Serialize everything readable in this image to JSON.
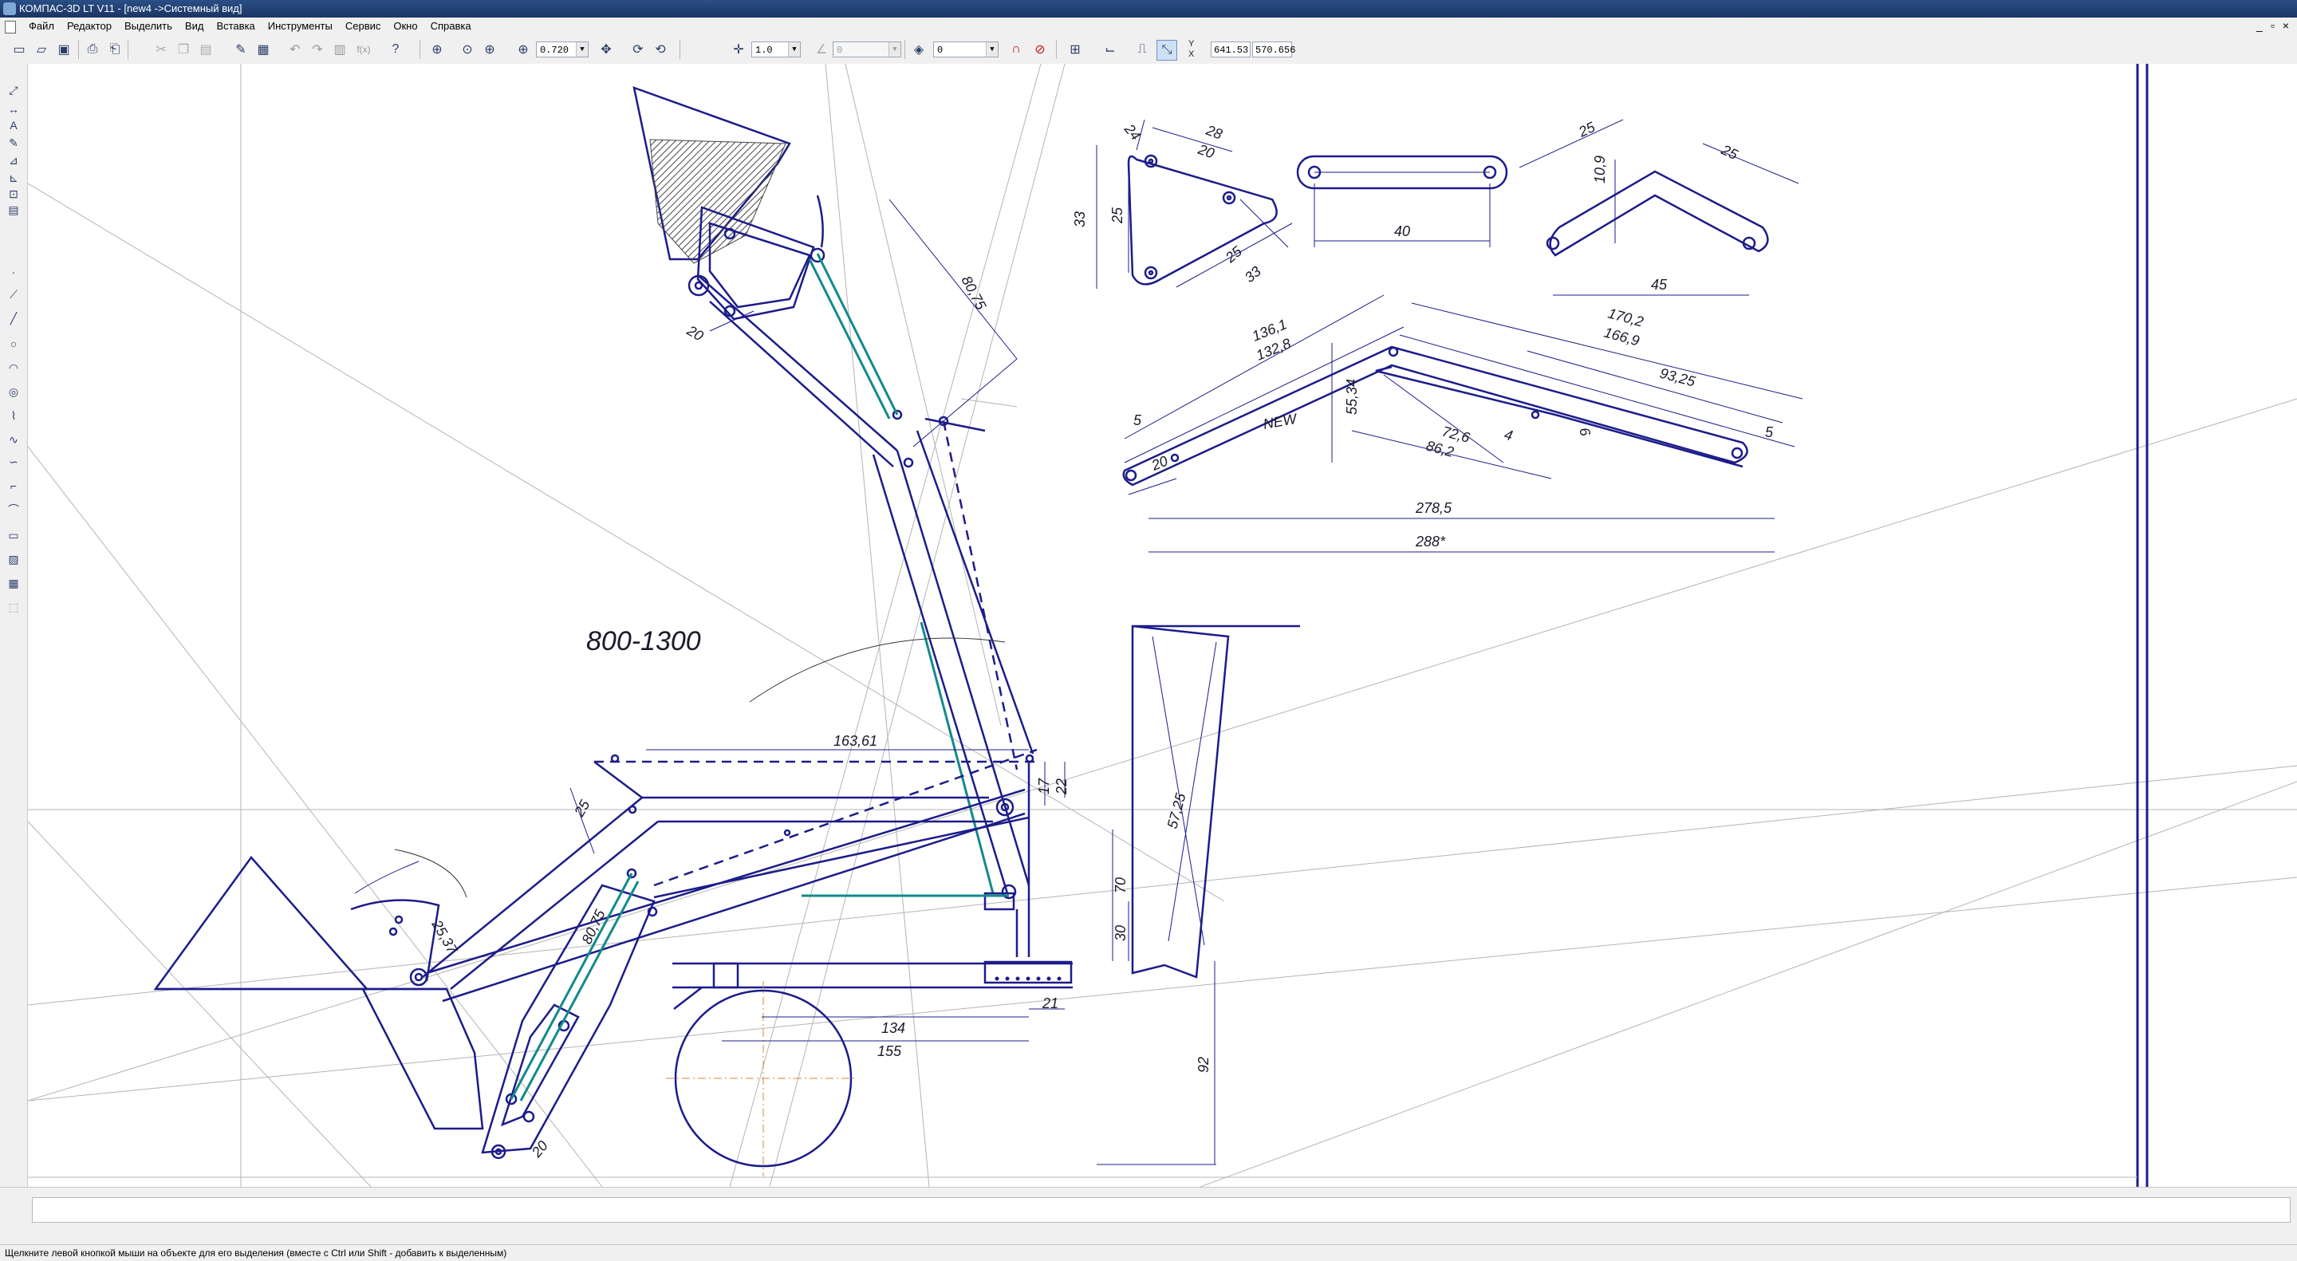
{
  "window": {
    "title": "КОМПАС-3D LT V11 - [new4 ->Системный вид]",
    "controls": [
      "_",
      "▫",
      "×"
    ]
  },
  "menu": {
    "items": [
      "Файл",
      "Редактор",
      "Выделить",
      "Вид",
      "Вставка",
      "Инструменты",
      "Сервис",
      "Окно",
      "Справка"
    ]
  },
  "toolbar": {
    "zoom_value": "0.720",
    "step_value": "1.0",
    "angle_value": "0",
    "layer_value": "0",
    "coord_x": "641.53",
    "coord_y": "570.656",
    "coord_labels": [
      "Y",
      "X"
    ]
  },
  "drawing": {
    "range_label": "800-1300",
    "part_new_label": "NEW",
    "dims": {
      "d_80_75_top": "80,75",
      "d_20_bucket": "20",
      "d_24": "24",
      "d_28": "28",
      "d_20_tri": "20",
      "d_33_v": "33",
      "d_25_v": "25",
      "d_25_tri": "25",
      "d_33_tri": "33",
      "d_40": "40",
      "d_25_a": "25",
      "d_25_b": "25",
      "d_10_9": "10,9",
      "d_45": "45",
      "d_136_1": "136,1",
      "d_132_8": "132,8",
      "d_170_2": "170,2",
      "d_166_9": "166,9",
      "d_93_25": "93,25",
      "d_55_34": "55,34",
      "d_72_6": "72,6",
      "d_86_2": "86,2",
      "d_4": "4",
      "d_6": "6",
      "d_5_left": "5",
      "d_5_right": "5",
      "d_20_arm": "20",
      "d_278_5": "278,5",
      "d_288": "288*",
      "d_163_61": "163,61",
      "d_25_low": "25",
      "d_17": "17",
      "d_22": "22",
      "d_57_25": "57,25",
      "d_70": "70",
      "d_30": "30",
      "d_25_37": "25,37",
      "d_80_75_low": "80,75",
      "d_134": "134",
      "d_155": "155",
      "d_21": "21",
      "d_92": "92",
      "d_20_low": "20"
    }
  },
  "status": {
    "hint": "Щелкните левой кнопкой мыши на объекте для его выделения (вместе с Ctrl или Shift - добавить к выделенным)"
  },
  "colors": {
    "line_main": "#1c1c8a",
    "line_teal": "#138a8a",
    "line_construct": "#b4b4b4",
    "hatch": "#444444"
  }
}
